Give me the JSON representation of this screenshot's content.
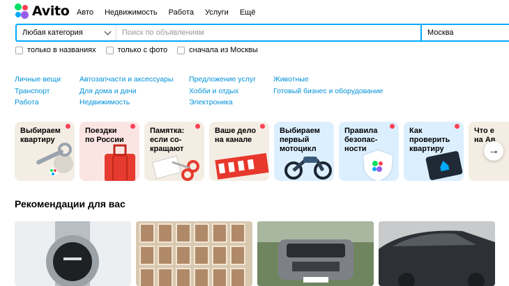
{
  "logo": {
    "text": "Avito"
  },
  "nav": [
    {
      "label": "Авто"
    },
    {
      "label": "Недвижимость"
    },
    {
      "label": "Работа"
    },
    {
      "label": "Услуги"
    },
    {
      "label": "Ещё"
    }
  ],
  "search": {
    "category": "Любая категория",
    "placeholder": "Поиск по объявлениям",
    "city": "Москва"
  },
  "filters": [
    {
      "label": "только в названиях"
    },
    {
      "label": "только с фото"
    },
    {
      "label": "сначала из Москвы"
    }
  ],
  "categories": [
    [
      "Личные вещи",
      "Транспорт",
      "Работа"
    ],
    [
      "Автозапчасти и аксессуары",
      "Для дома и дачи",
      "Недвижимость"
    ],
    [
      "Предложение услуг",
      "Хобби и отдых",
      "Электроника"
    ],
    [
      "Животные",
      "Готовый бизнес и оборудование"
    ]
  ],
  "stories": [
    {
      "title": "Выбираем\nквартиру",
      "icon": "keys-icon",
      "bg": "#f4ede4"
    },
    {
      "title": "Поездки\nпо России",
      "icon": "suitcase-icon",
      "bg": "#fbe5e3"
    },
    {
      "title": "Памятка:\nесли со-\nкращают",
      "icon": "scissors-icon",
      "bg": "#f4ede4"
    },
    {
      "title": "Ваше дело\nна канале",
      "icon": "friday-sticker-icon",
      "bg": "#f4ede4"
    },
    {
      "title": "Выбираем\nпервый\nмотоцикл",
      "icon": "motorcycle-icon",
      "bg": "#dcefff"
    },
    {
      "title": "Правила\nбезопас-\nности",
      "icon": "shield-icon",
      "bg": "#dcefff"
    },
    {
      "title": "Как\nпроверить\nквартиру",
      "icon": "tablet-icon",
      "bg": "#dcefff"
    },
    {
      "title": "Что е\nна Ав",
      "icon": "story-icon",
      "bg": "#f4ede4"
    }
  ],
  "recommendations": {
    "title": "Рекомендации для вас",
    "items": [
      {
        "icon": "watch-photo"
      },
      {
        "icon": "stamps-photo"
      },
      {
        "icon": "suv-photo"
      },
      {
        "icon": "car-photo"
      }
    ]
  },
  "colors": {
    "accent": "#00aaff",
    "link": "#0091d9",
    "badge": "#ff4053"
  }
}
